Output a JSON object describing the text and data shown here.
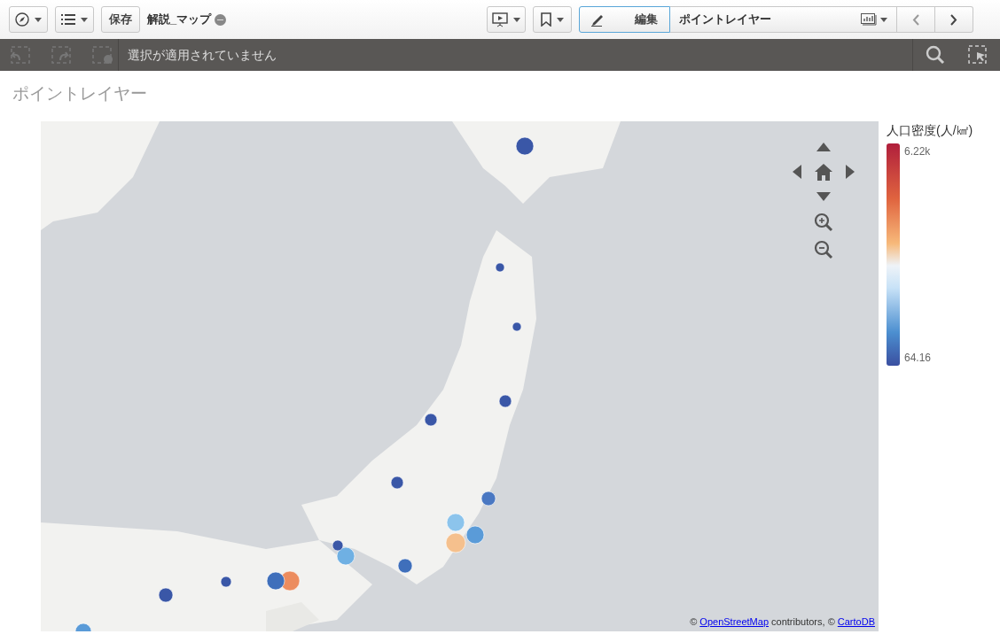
{
  "toolbar": {
    "save": "保存",
    "app_title": "解説_マップ",
    "edit": "編集",
    "sheet_title": "ポイントレイヤー"
  },
  "selection_bar": {
    "message": "選択が適用されていません"
  },
  "sheet": {
    "title": "ポイントレイヤー"
  },
  "map": {
    "attribution": [
      {
        "kind": "text",
        "text": "© "
      },
      {
        "kind": "link",
        "text": "OpenStreetMap"
      },
      {
        "kind": "text",
        "text": " contributors, © "
      },
      {
        "kind": "link",
        "text": "CartoDB"
      }
    ]
  },
  "legend": {
    "title": "人口密度(人/㎢)",
    "max": "6.22k",
    "min": "64.16"
  }
}
